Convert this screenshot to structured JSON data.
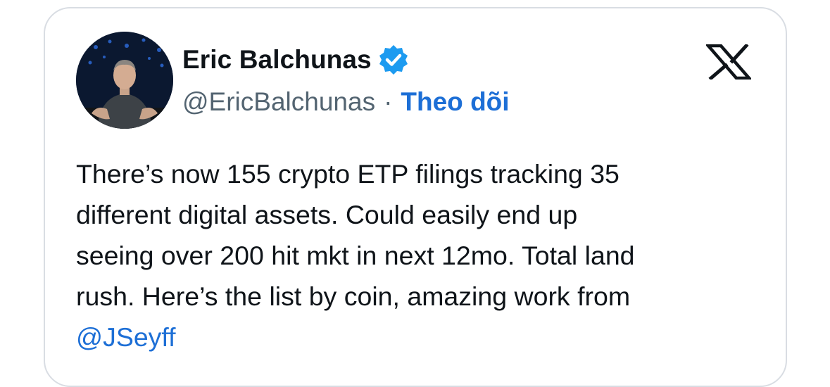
{
  "author": {
    "name": "Eric Balchunas",
    "handle": "@EricBalchunas",
    "separator": "·",
    "follow_label": "Theo dõi",
    "verified": true
  },
  "brand": {
    "logo": "x-logo-icon"
  },
  "tweet": {
    "lines": [
      "There’s now 155 crypto ETP filings tracking 35",
      "different digital assets. Could easily end up",
      "seeing over 200 hit mkt in next 12mo. Total land",
      "rush. Here’s the list by coin, amazing work from"
    ],
    "mention": "@JSeyff"
  },
  "colors": {
    "link": "#1d6fd6",
    "verified_badge": "#1d9bf0",
    "text": "#0f1419",
    "secondary_text": "#536471",
    "border": "#d9dde3"
  }
}
